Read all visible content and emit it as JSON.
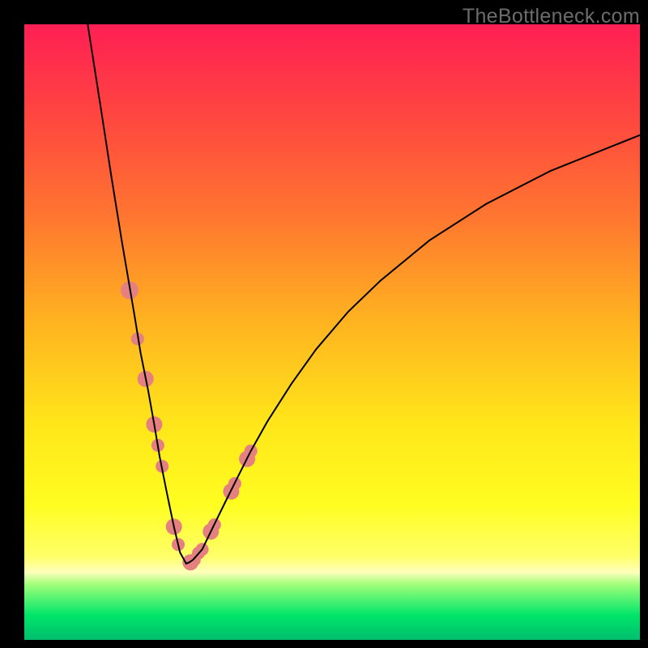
{
  "watermark": "TheBottleneck.com",
  "colors": {
    "background": "#000000",
    "dot": "#e58080",
    "curve": "#000000",
    "gradient_top": "#ff1f54",
    "gradient_bottom": "#00be6e"
  },
  "chart_data": {
    "type": "line",
    "title": "",
    "xlabel": "",
    "ylabel": "",
    "xlim": [
      0,
      100
    ],
    "ylim": [
      0,
      100
    ],
    "grid": false,
    "legend": false,
    "notes": "No axes, ticks, labels, or legend are rendered. Background is a vertical red→green gradient. A black V-shaped curve descends from upper-left to a minimum near x≈25 and rises toward upper-right. Salmon dots cluster along both curve legs near the bottom of the V.",
    "series": [
      {
        "name": "left_leg",
        "x": [
          10.3,
          12.8,
          14.1,
          15.8,
          17.8,
          18.9,
          20.1,
          21.1,
          22.0,
          23.2,
          24.3,
          25.3
        ],
        "y": [
          100,
          84,
          75.5,
          65,
          53.3,
          46.6,
          40.6,
          35,
          29.7,
          23.7,
          18.4,
          14.2
        ]
      },
      {
        "name": "valley",
        "x": [
          25.3,
          26.3,
          26.8,
          27.4,
          28.9,
          30.3
        ],
        "y": [
          14.2,
          12.4,
          12.6,
          13.0,
          14.7,
          17.6
        ]
      },
      {
        "name": "right_leg",
        "x": [
          30.3,
          32.9,
          34.5,
          36.8,
          39.5,
          43.4,
          47.4,
          52.6,
          57.9,
          65.8,
          75.0,
          85.5,
          100.0
        ],
        "y": [
          17.6,
          22.9,
          26.1,
          30.7,
          35.5,
          41.6,
          47.2,
          53.3,
          58.4,
          64.9,
          70.8,
          76.2,
          82.0
        ]
      }
    ],
    "dots": {
      "name": "markers",
      "x": [
        17.1,
        18.4,
        19.7,
        21.1,
        21.7,
        22.4,
        24.3,
        25.0,
        27.0,
        27.6,
        28.3,
        28.9,
        30.3,
        30.9,
        33.6,
        34.2,
        36.2,
        36.8
      ],
      "y": [
        56.8,
        48.9,
        42.4,
        35.0,
        31.6,
        28.2,
        18.4,
        15.5,
        12.6,
        13.0,
        14.1,
        14.7,
        17.6,
        18.7,
        24.1,
        25.4,
        29.4,
        30.7
      ],
      "r": [
        11,
        8,
        10,
        10,
        8,
        8,
        10,
        8,
        10,
        8,
        8,
        8,
        10,
        8,
        10,
        8,
        10,
        8
      ]
    }
  }
}
